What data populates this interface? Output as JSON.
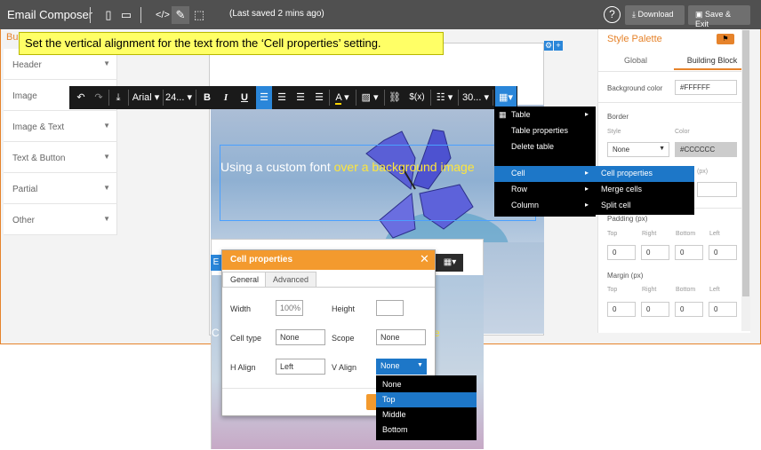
{
  "topbar": {
    "app_title": "Email Composer",
    "saved_status": "(Last saved 2 mins ago)",
    "download_label": "Download",
    "save_exit_label": "Save & Exit",
    "help_label": "?"
  },
  "instruction": "Set the vertical alignment for the text from the ‘Cell properties’ setting.",
  "left_panel": {
    "header_prefix": "Bu",
    "items": [
      {
        "label": "Header"
      },
      {
        "label": "Image"
      },
      {
        "label": "Image & Text"
      },
      {
        "label": "Text & Button"
      },
      {
        "label": "Partial"
      },
      {
        "label": "Other"
      }
    ]
  },
  "format_toolbar": {
    "font_family": "Arial",
    "font_size": "24...",
    "bold": "B",
    "italic": "I",
    "underline": "U",
    "font_color": "A",
    "variable": "$(x)",
    "line_height": "30..."
  },
  "canvas": {
    "hero_text_white": "Using a custom font",
    "hero_text_yellow": "over a background image",
    "lower_text_white": "C",
    "lower_text_yellow": "e"
  },
  "table_menu": {
    "items": [
      {
        "label": "Table",
        "has_sub": true
      },
      {
        "label": "Table properties",
        "has_sub": false
      },
      {
        "label": "Delete table",
        "has_sub": false
      },
      {
        "label": "Cell",
        "has_sub": true
      },
      {
        "label": "Row",
        "has_sub": true
      },
      {
        "label": "Column",
        "has_sub": true
      }
    ]
  },
  "cell_submenu": {
    "items": [
      {
        "label": "Cell properties"
      },
      {
        "label": "Merge cells"
      },
      {
        "label": "Split cell"
      }
    ]
  },
  "style_palette": {
    "title": "Style Palette",
    "tabs": [
      "Global",
      "Building Block"
    ],
    "background_color_label": "Background color",
    "background_color_value": "#FFFFFF",
    "border_label": "Border",
    "border_style_label": "Style",
    "border_color_label": "Color",
    "border_style_value": "None",
    "border_color_value": "#CCCCCC",
    "radius_suffix": "(px)",
    "padding_label": "Padding (px)",
    "margin_label": "Margin (px)",
    "sides": [
      "Top",
      "Right",
      "Bottom",
      "Left"
    ],
    "padding_values": [
      "0",
      "0",
      "0",
      "0"
    ],
    "margin_values": [
      "0",
      "0",
      "0",
      "0"
    ]
  },
  "cell_properties_dialog": {
    "title": "Cell properties",
    "close_label": "✕",
    "tabs": [
      "General",
      "Advanced"
    ],
    "width_label": "Width",
    "width_value": "100%",
    "height_label": "Height",
    "height_value": "",
    "cell_type_label": "Cell type",
    "cell_type_value": "None",
    "scope_label": "Scope",
    "scope_value": "None",
    "h_align_label": "H Align",
    "h_align_value": "Left",
    "v_align_label": "V Align",
    "v_align_value": "None",
    "v_align_options": [
      "None",
      "Top",
      "Middle",
      "Bottom"
    ],
    "v_align_highlighted": "Top"
  },
  "colors": {
    "accent_orange": "#f39a2e",
    "selection_blue": "#1d77c8",
    "toolbar_dark": "#1a1a1a",
    "topbar_gray": "#505050",
    "instruction_yellow": "#ffff66"
  }
}
